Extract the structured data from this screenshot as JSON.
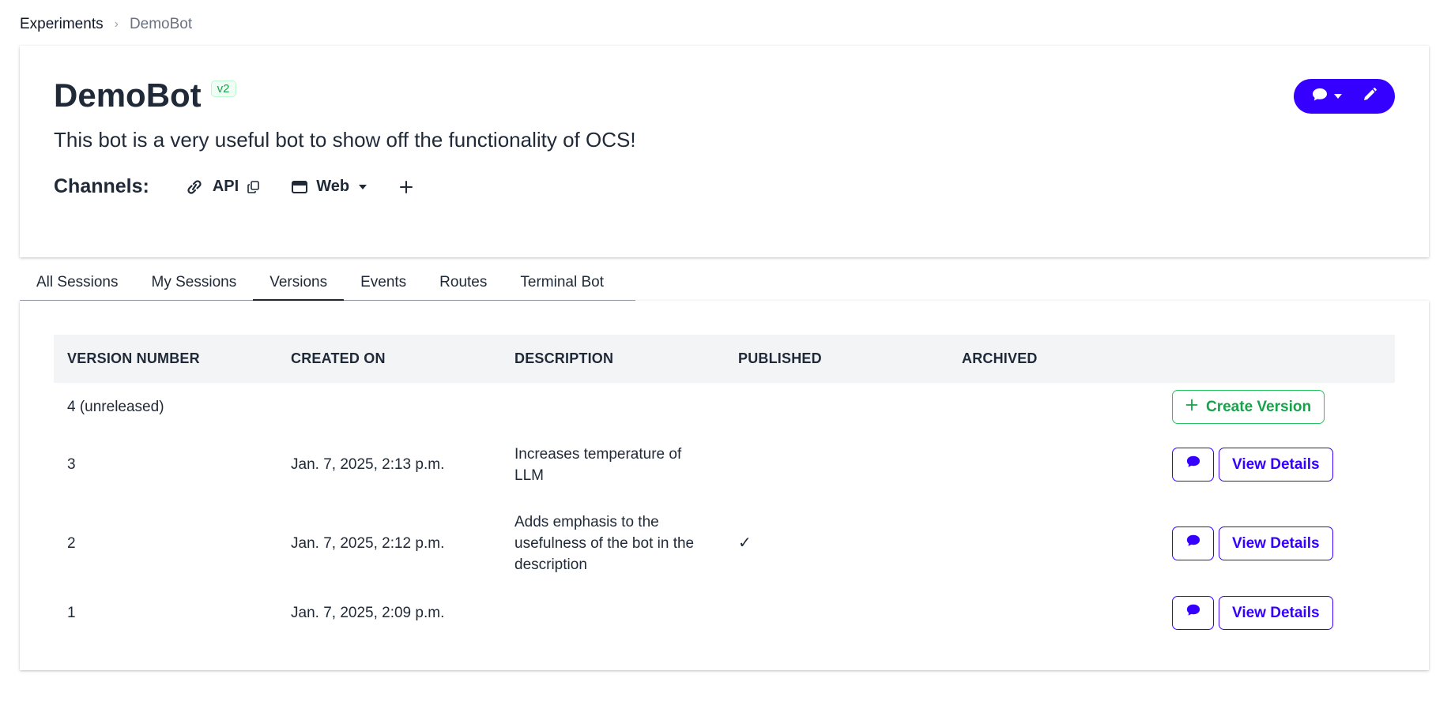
{
  "breadcrumb": {
    "root": "Experiments",
    "separator": "›",
    "current": "DemoBot"
  },
  "experiment": {
    "name": "DemoBot",
    "version_badge": "v2",
    "description": "This bot is a very useful bot to show off the functionality of OCS!",
    "channels_label": "Channels:",
    "channels": [
      {
        "name": "API",
        "icon": "link-icon",
        "extra_icon": "copy-icon"
      },
      {
        "name": "Web",
        "icon": "browser-window-icon",
        "extra_icon": "caret-down-icon"
      }
    ],
    "add_channel_icon": "plus-icon"
  },
  "actions": {
    "chat_menu_icon": "chat-bubble-icon",
    "edit_icon": "pencil-icon"
  },
  "tabs": [
    {
      "label": "All Sessions",
      "active": false
    },
    {
      "label": "My Sessions",
      "active": false
    },
    {
      "label": "Versions",
      "active": true
    },
    {
      "label": "Events",
      "active": false
    },
    {
      "label": "Routes",
      "active": false
    },
    {
      "label": "Terminal Bot",
      "active": false
    }
  ],
  "table": {
    "headers": [
      "VERSION NUMBER",
      "CREATED ON",
      "DESCRIPTION",
      "PUBLISHED",
      "ARCHIVED",
      ""
    ],
    "rows": [
      {
        "version": "4 (unreleased)",
        "created": "",
        "description": "",
        "published": "",
        "archived": "",
        "action": "Create Version"
      },
      {
        "version": "3",
        "created": "Jan. 7, 2025, 2:13 p.m.",
        "description": "Increases temperature of LLM",
        "published": "",
        "archived": "",
        "action": "View Details"
      },
      {
        "version": "2",
        "created": "Jan. 7, 2025, 2:12 p.m.",
        "description": "Adds emphasis to the usefulness of the bot in the description",
        "published": "✓",
        "archived": "",
        "action": "View Details"
      },
      {
        "version": "1",
        "created": "Jan. 7, 2025, 2:09 p.m.",
        "description": "",
        "published": "",
        "archived": "",
        "action": "View Details"
      }
    ]
  },
  "colors": {
    "primary": "#3500ff",
    "success": "#16a34a",
    "text": "#1f2937",
    "header_bg": "#f3f4f6"
  }
}
